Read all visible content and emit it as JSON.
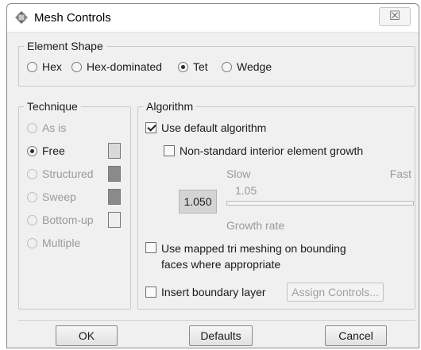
{
  "window": {
    "title": "Mesh Controls",
    "close_glyph": "☒"
  },
  "element_shape": {
    "label": "Element Shape",
    "options": [
      {
        "label": "Hex",
        "selected": false
      },
      {
        "label": "Hex-dominated",
        "selected": false
      },
      {
        "label": "Tet",
        "selected": true
      },
      {
        "label": "Wedge",
        "selected": false
      }
    ]
  },
  "technique": {
    "label": "Technique",
    "options": [
      {
        "label": "As is",
        "selected": false,
        "enabled": false
      },
      {
        "label": "Free",
        "selected": true,
        "enabled": true,
        "swatch_color": "#d9d9d9"
      },
      {
        "label": "Structured",
        "selected": false,
        "enabled": false,
        "swatch_color": "#8a8a8a"
      },
      {
        "label": "Sweep",
        "selected": false,
        "enabled": false,
        "swatch_color": "#8a8a8a"
      },
      {
        "label": "Bottom-up",
        "selected": false,
        "enabled": false,
        "swatch_color": "#eeeeee"
      },
      {
        "label": "Multiple",
        "selected": false,
        "enabled": false
      }
    ]
  },
  "algorithm": {
    "label": "Algorithm",
    "use_default": {
      "label": "Use default algorithm",
      "checked": true
    },
    "non_standard": {
      "label": "Non-standard interior element growth",
      "checked": false
    },
    "slider": {
      "slow_label": "Slow",
      "fast_label": "Fast",
      "current_value": "1.05",
      "value_box": "1.050",
      "caption": "Growth rate"
    },
    "mapped_tri": {
      "label_line1": "Use mapped tri meshing on bounding",
      "label_line2": "faces where appropriate",
      "checked": false
    },
    "boundary_layer": {
      "label": "Insert boundary layer",
      "checked": false
    },
    "assign_controls": "Assign Controls..."
  },
  "buttons": {
    "ok": "OK",
    "defaults": "Defaults",
    "cancel": "Cancel"
  },
  "colors": {
    "dialog_bg": "#f0f0f0",
    "group_border": "#c9c9c9",
    "disabled_text": "#9a9a9a"
  }
}
